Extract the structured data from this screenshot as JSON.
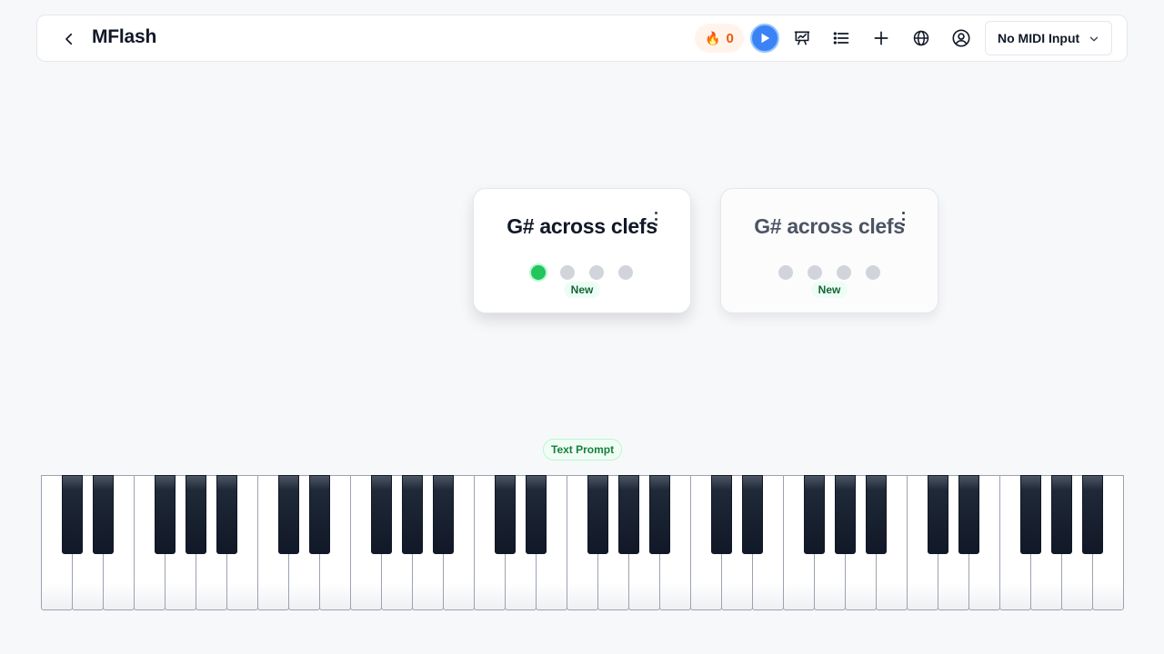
{
  "header": {
    "app_title": "MFlash",
    "back_icon": "chevron-left-icon",
    "streak_icon": "🔥",
    "streak_count": "0",
    "midi_select_value": "No MIDI Input",
    "toolbar_icons": [
      "play-icon",
      "chart-presentation-icon",
      "list-icon",
      "plus-icon",
      "globe-icon",
      "user-circle-icon",
      "chevron-down-icon"
    ]
  },
  "cards": [
    {
      "title": "G# across clefs",
      "badge": "New",
      "progress_dots": [
        true,
        false,
        false,
        false
      ],
      "active": true
    },
    {
      "title": "G# across clefs",
      "badge": "New",
      "progress_dots": [
        false,
        false,
        false,
        false
      ],
      "active": false
    }
  ],
  "prompt_mode": "Text Prompt",
  "keyboard": {
    "white_keys": 35,
    "octaves": 5
  },
  "colors": {
    "accent": "#3b82f6",
    "success": "#22c55e",
    "streak": "#ea580c",
    "background": "#f7f8fa"
  }
}
